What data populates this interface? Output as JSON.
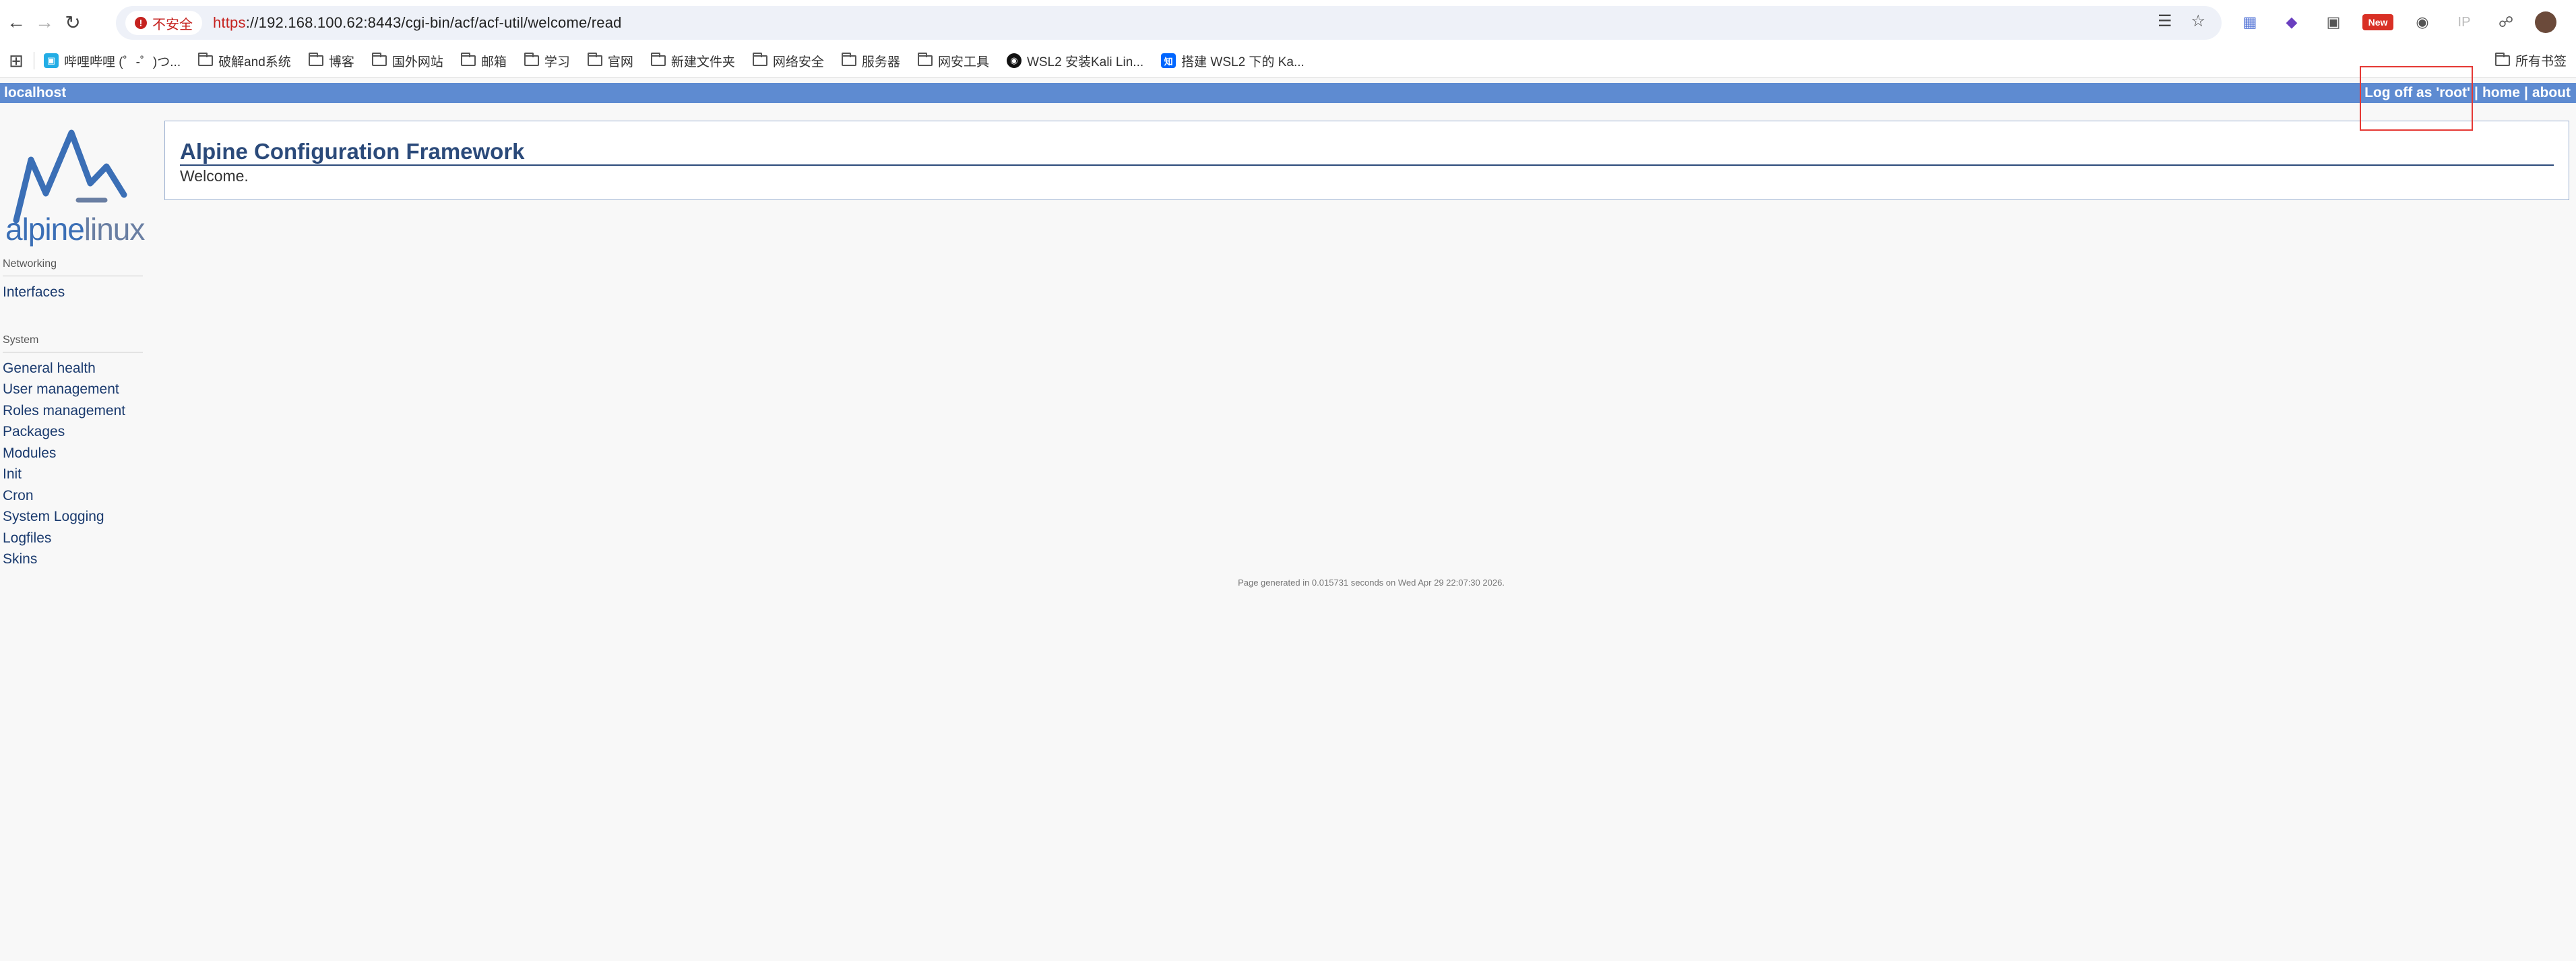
{
  "browser": {
    "security_label": "不安全",
    "url_scheme": "https",
    "url_rest": "://192.168.100.62:8443/cgi-bin/acf/acf-util/welcome/read",
    "bookmarks": [
      {
        "label": "哔哩哔哩 (゜-゜)つ...",
        "icon": "bilibili-icon"
      },
      {
        "label": "破解and系统",
        "icon": "folder-icon"
      },
      {
        "label": "博客",
        "icon": "folder-icon"
      },
      {
        "label": "国外网站",
        "icon": "folder-icon"
      },
      {
        "label": "邮箱",
        "icon": "folder-icon"
      },
      {
        "label": "学习",
        "icon": "folder-icon"
      },
      {
        "label": "官网",
        "icon": "folder-icon"
      },
      {
        "label": "新建文件夹",
        "icon": "folder-icon"
      },
      {
        "label": "网络安全",
        "icon": "folder-icon"
      },
      {
        "label": "服务器",
        "icon": "folder-icon"
      },
      {
        "label": "网安工具",
        "icon": "folder-icon"
      },
      {
        "label": "WSL2 安装Kali Lin...",
        "icon": "kali-icon"
      },
      {
        "label": "搭建 WSL2 下的 Ka...",
        "icon": "zhihu-icon"
      }
    ],
    "all_bookmarks": "所有书签",
    "ext_new_badge": "New",
    "ext_ip_label": "IP"
  },
  "header": {
    "hostname": "localhost",
    "logoff": "Log off as 'root'",
    "separator": "|",
    "home": "home",
    "about": "about"
  },
  "logo": {
    "part1": "alpine",
    "part2": "linux"
  },
  "nav": {
    "networking_label": "Networking",
    "networking_items": [
      "Interfaces"
    ],
    "system_label": "System",
    "system_items": [
      "General health",
      "User management",
      "Roles management",
      "Packages",
      "Modules",
      "Init",
      "Cron",
      "System Logging",
      "Logfiles",
      "Skins"
    ]
  },
  "content": {
    "title": "Alpine Configuration Framework",
    "body": "Welcome."
  },
  "footer": "Page generated in 0.015731 seconds on Wed Apr 29 22:07:30 2026.",
  "colors": {
    "header_bar": "#5e8bd1",
    "highlight": "#e53935"
  }
}
